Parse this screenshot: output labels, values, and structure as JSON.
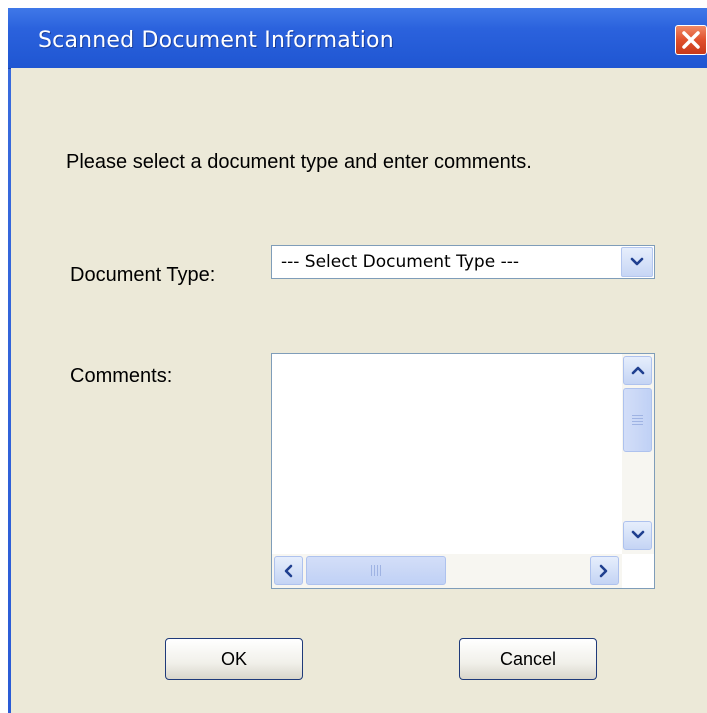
{
  "window": {
    "title": "Scanned Document Information"
  },
  "form": {
    "instructions": "Please select a document type and enter comments.",
    "document_type_label": "Document Type:",
    "document_type_selected": "--- Select Document Type ---",
    "comments_label": "Comments:",
    "comments_value": ""
  },
  "buttons": {
    "ok": "OK",
    "cancel": "Cancel"
  },
  "icons": {
    "close": "close-icon",
    "dropdown": "chevron-down-icon",
    "scroll_up": "chevron-up-icon",
    "scroll_down": "chevron-down-icon",
    "scroll_left": "chevron-left-icon",
    "scroll_right": "chevron-right-icon"
  },
  "colors": {
    "titlebar": "#2b62dd",
    "client": "#ece9d8",
    "close_button": "#e0502c",
    "button_border": "#1f3a7a"
  }
}
